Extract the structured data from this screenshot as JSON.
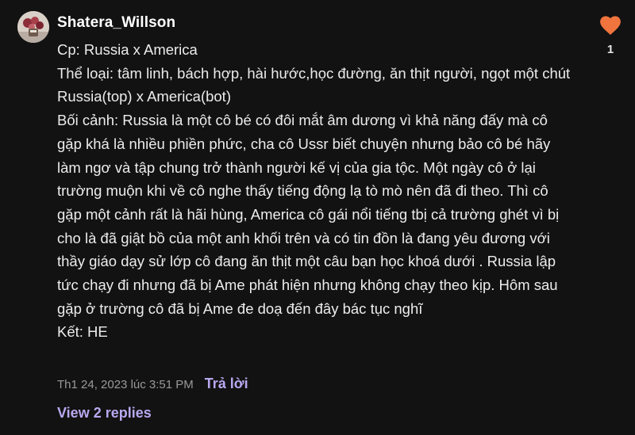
{
  "comment": {
    "username": "Shatera_Willson",
    "lines": [
      "Cp: Russia x America",
      "Thể loại: tâm linh, bách hợp, hài hước,học đường, ăn thịt người, ngọt một chút",
      "Russia(top) x America(bot)",
      "Bối cảnh: Russia là một cô bé có đôi mắt âm dương vì khả năng đấy mà cô gặp khá là nhiều phiền phức, cha cô Ussr biết chuyện nhưng bảo cô bé hãy làm ngơ và tập chung trở thành người kế vị của gia tộc. Một ngày cô ở lại trường muộn khi về cô nghe thấy tiếng động lạ tò mò nên đã đi theo. Thì cô gặp một cảnh rất là hãi hùng, America cô gái nổi tiếng tbị cả trường ghét vì bị cho là đã giật bồ của một anh khối trên và có tin đồn là đang yêu đương với thầy giáo dạy sử lớp cô đang ăn thịt một câu bạn học khoá dưới . Russia lập tức chạy đi nhưng đã bị Ame phát hiện nhưng không chạy theo kịp. Hôm sau gặp ở trường cô đã bị Ame đe doạ đến đây bác tục nghĩ",
      "Kết: HE"
    ],
    "timestamp": "Th1 24, 2023 lúc 3:51 PM",
    "reply_label": "Trả lời",
    "view_replies_label": "View 2 replies",
    "like_count": "1",
    "like_icon": "heart-icon",
    "accent_color": "#b9a8f0",
    "heart_color": "#f0743e"
  }
}
